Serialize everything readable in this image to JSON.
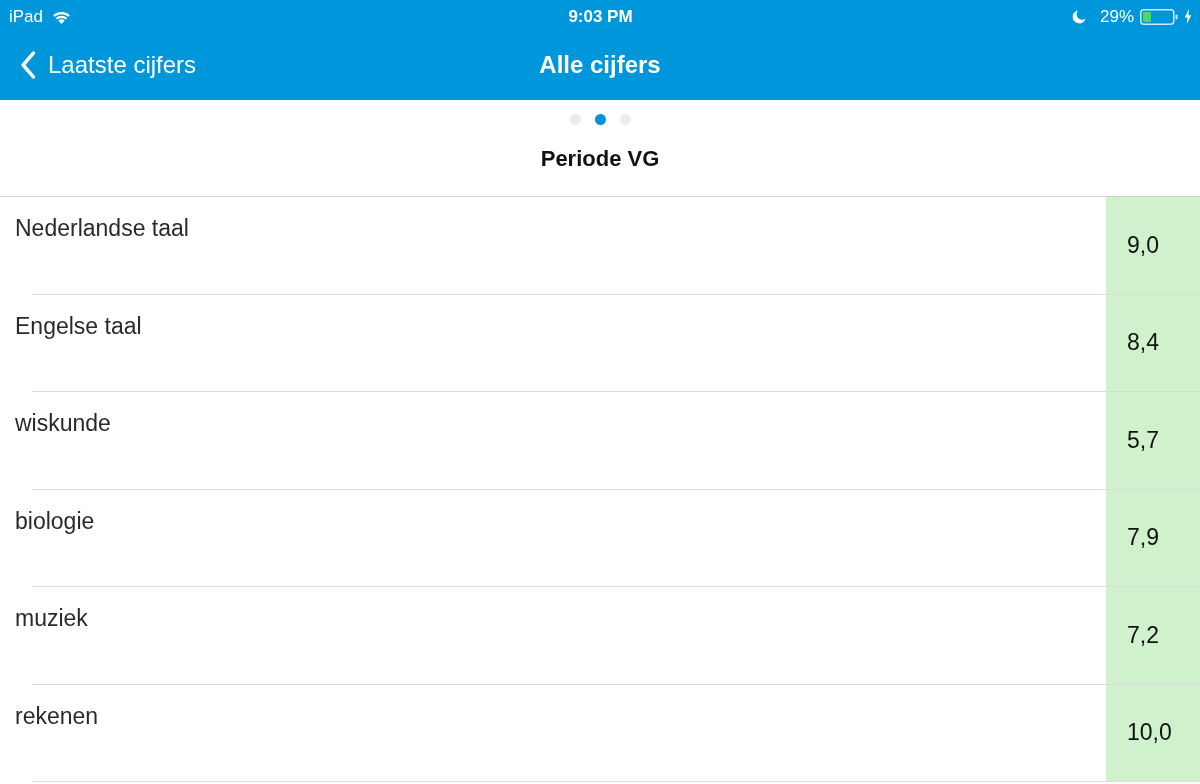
{
  "status_bar": {
    "device": "iPad",
    "time": "9:03 PM",
    "battery": "29%"
  },
  "nav_bar": {
    "back": "Laatste cijfers",
    "title": "Alle cijfers"
  },
  "page_dots": [
    {
      "selected": false
    },
    {
      "selected": true
    },
    {
      "selected": false
    }
  ],
  "section_title": "Periode VG",
  "grades": [
    {
      "subject": "Nederlandse taal",
      "grade": "9,0"
    },
    {
      "subject": "Engelse taal",
      "grade": "8,4"
    },
    {
      "subject": "wiskunde",
      "grade": "5,7"
    },
    {
      "subject": "biologie",
      "grade": "7,9"
    },
    {
      "subject": "muziek",
      "grade": "7,2"
    },
    {
      "subject": "rekenen",
      "grade": "10,0"
    }
  ]
}
